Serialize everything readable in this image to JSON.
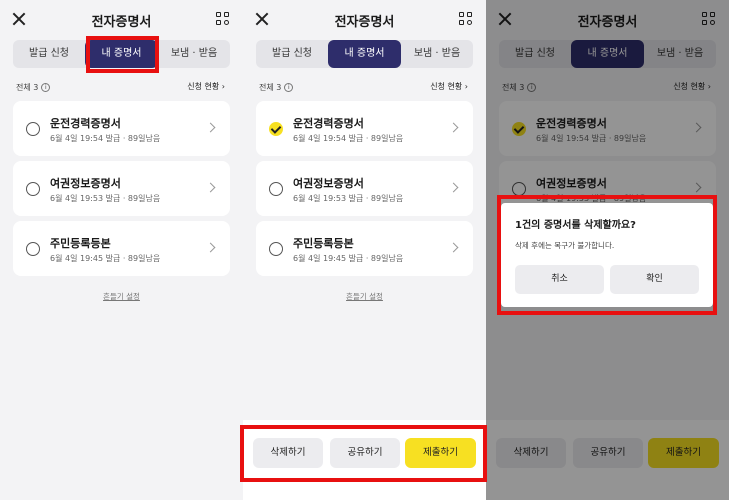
{
  "header": {
    "title": "전자증명서"
  },
  "tabs": [
    "발급 신청",
    "내 증명서",
    "보냄 · 받음"
  ],
  "summary": {
    "total_label": "전체 3",
    "status_link": "신청 현황"
  },
  "certificates": [
    {
      "name": "운전경력증명서",
      "meta": "6월 4일 19:54 발급 · 89일남음"
    },
    {
      "name": "여권정보증명서",
      "meta": "6월 4일 19:53 발급 · 89일남음"
    },
    {
      "name": "주민등록등본",
      "meta": "6월 4일 19:45 발급 · 89일남음"
    }
  ],
  "shake_setting": "흔들기 설정",
  "actions": {
    "delete": "삭제하기",
    "share": "공유하기",
    "submit": "제출하기"
  },
  "dialog": {
    "title": "1건의 증명서를 삭제할까요?",
    "body": "삭제 후에는 복구가 불가합니다.",
    "cancel": "취소",
    "confirm": "확인"
  },
  "colors": {
    "active_tab": "#2e2d6b",
    "accent_yellow": "#f7e022",
    "highlight": "#e81010"
  }
}
